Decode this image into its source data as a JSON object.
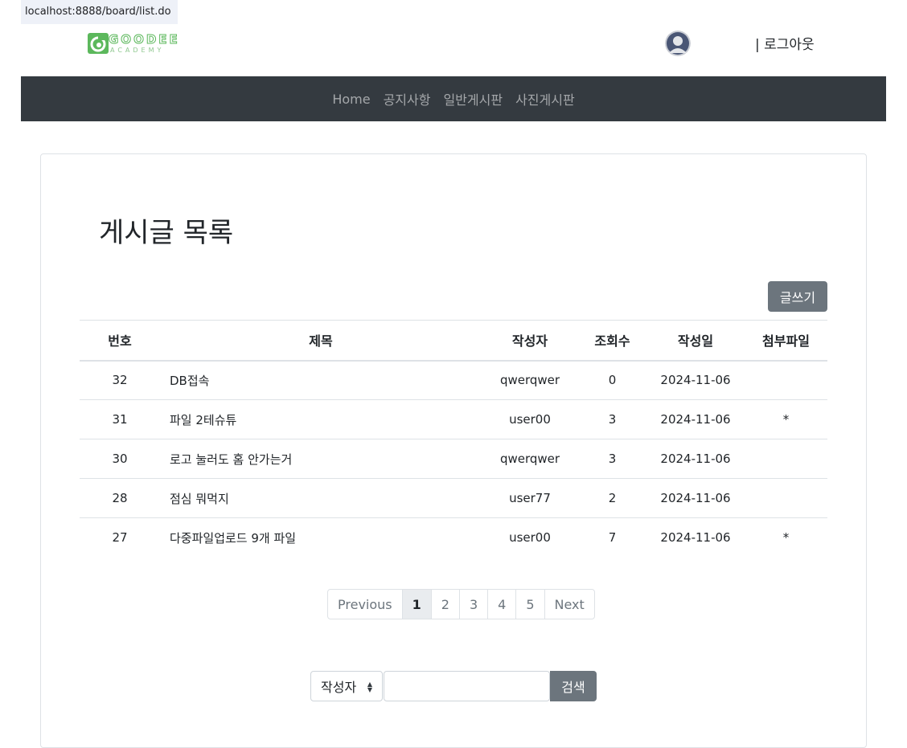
{
  "url_tooltip": "localhost:8888/board/list.do",
  "header": {
    "logo_text": "GOODEE",
    "logo_sub": "ACADEMY",
    "logout_label": "| 로그아웃"
  },
  "nav": {
    "items": [
      "Home",
      "공지사항",
      "일반게시판",
      "사진게시판"
    ]
  },
  "page_title": "게시글 목록",
  "write_button": "글쓰기",
  "table": {
    "headers": [
      "번호",
      "제목",
      "작성자",
      "조회수",
      "작성일",
      "첨부파일"
    ],
    "rows": [
      {
        "no": "32",
        "subject": "DB접속",
        "writer": "qwerqwer",
        "views": "0",
        "date": "2024-11-06",
        "attach": ""
      },
      {
        "no": "31",
        "subject": "파일 2테슈튜",
        "writer": "user00",
        "views": "3",
        "date": "2024-11-06",
        "attach": "*"
      },
      {
        "no": "30",
        "subject": "로고 눌러도 홈 안가는거",
        "writer": "qwerqwer",
        "views": "3",
        "date": "2024-11-06",
        "attach": ""
      },
      {
        "no": "28",
        "subject": "점심 뭐먹지",
        "writer": "user77",
        "views": "2",
        "date": "2024-11-06",
        "attach": ""
      },
      {
        "no": "27",
        "subject": "다중파일업로드 9개 파일",
        "writer": "user00",
        "views": "7",
        "date": "2024-11-06",
        "attach": "*"
      }
    ]
  },
  "pagination": {
    "previous": "Previous",
    "pages": [
      "1",
      "2",
      "3",
      "4",
      "5"
    ],
    "next": "Next",
    "active": "1"
  },
  "search": {
    "select_value": "작성자",
    "input_value": "",
    "button_label": "검색"
  },
  "colors": {
    "navbar_bg": "#343a40",
    "button_secondary": "#6c757d",
    "logo_green": "#5cb85c"
  }
}
